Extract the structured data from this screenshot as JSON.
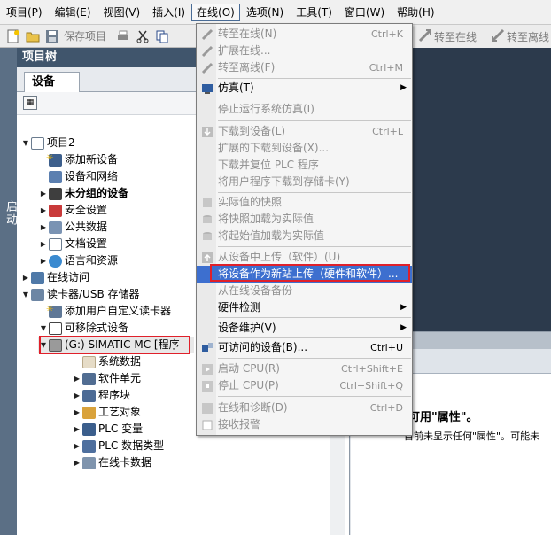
{
  "menubar": {
    "items": [
      "项目(P)",
      "编辑(E)",
      "视图(V)",
      "插入(I)",
      "在线(O)",
      "选项(N)",
      "工具(T)",
      "窗口(W)",
      "帮助(H)"
    ]
  },
  "toolbar": {
    "save_label": "保存项目",
    "go_online": "转至在线",
    "go_offline": "转至离线"
  },
  "left_strip": {
    "label": "启动"
  },
  "project_tree": {
    "title": "项目树",
    "tab": "设备",
    "rows": [
      "项目2",
      "添加新设备",
      "设备和网络",
      "未分组的设备",
      "安全设置",
      "公共数据",
      "文档设置",
      "语言和资源",
      "在线访问",
      "读卡器/USB 存储器",
      "添加用户自定义读卡器",
      "可移除式设备",
      "(G:) SIMATIC MC [程序",
      "系统数据",
      "软件单元",
      "程序块",
      "工艺对象",
      "PLC 变量",
      "PLC 数据类型",
      "在线卡数据"
    ]
  },
  "online_menu": {
    "go_online": "转至在线(N)",
    "go_online_key": "Ctrl+K",
    "ext_online": "扩展在线...",
    "go_offline": "转至离线(F)",
    "go_offline_key": "Ctrl+M",
    "simulation": "仿真(T)",
    "stop_sim": "停止运行系统仿真(I)",
    "download": "下载到设备(L)",
    "download_key": "Ctrl+L",
    "ext_download": "扩展的下载到设备(X)...",
    "download_reset": "下载并复位 PLC 程序",
    "download_card": "将用户程序下载到存储卡(Y)",
    "snapshot": "实际值的快照",
    "snapshot_to_actual": "将快照加载为实际值",
    "start_to_actual": "将起始值加载为实际值",
    "upload": "从设备中上传（软件）(U)",
    "upload_new_station": "将设备作为新站上传（硬件和软件）...",
    "upload_online": "从在线设备备份",
    "hw_detect": "硬件检测",
    "maintenance": "设备维护(V)",
    "accessible": "可访问的设备(B)...",
    "accessible_key": "Ctrl+U",
    "start_cpu": "启动 CPU(R)",
    "start_cpu_key": "Ctrl+Shift+E",
    "stop_cpu": "停止 CPU(P)",
    "stop_cpu_key": "Ctrl+Shift+Q",
    "diagnostics": "在线和诊断(D)",
    "diagnostics_key": "Ctrl+D",
    "receive_alarms": "接收报警"
  },
  "properties_panel": {
    "heading": "无可用\"属性\"。",
    "text": "目前未显示任何\"属性\"。可能未"
  },
  "colors": {
    "tree_title_bg": "#40556c",
    "menu_highlight": "#3d6fcf",
    "red_box": "#e0202a"
  }
}
